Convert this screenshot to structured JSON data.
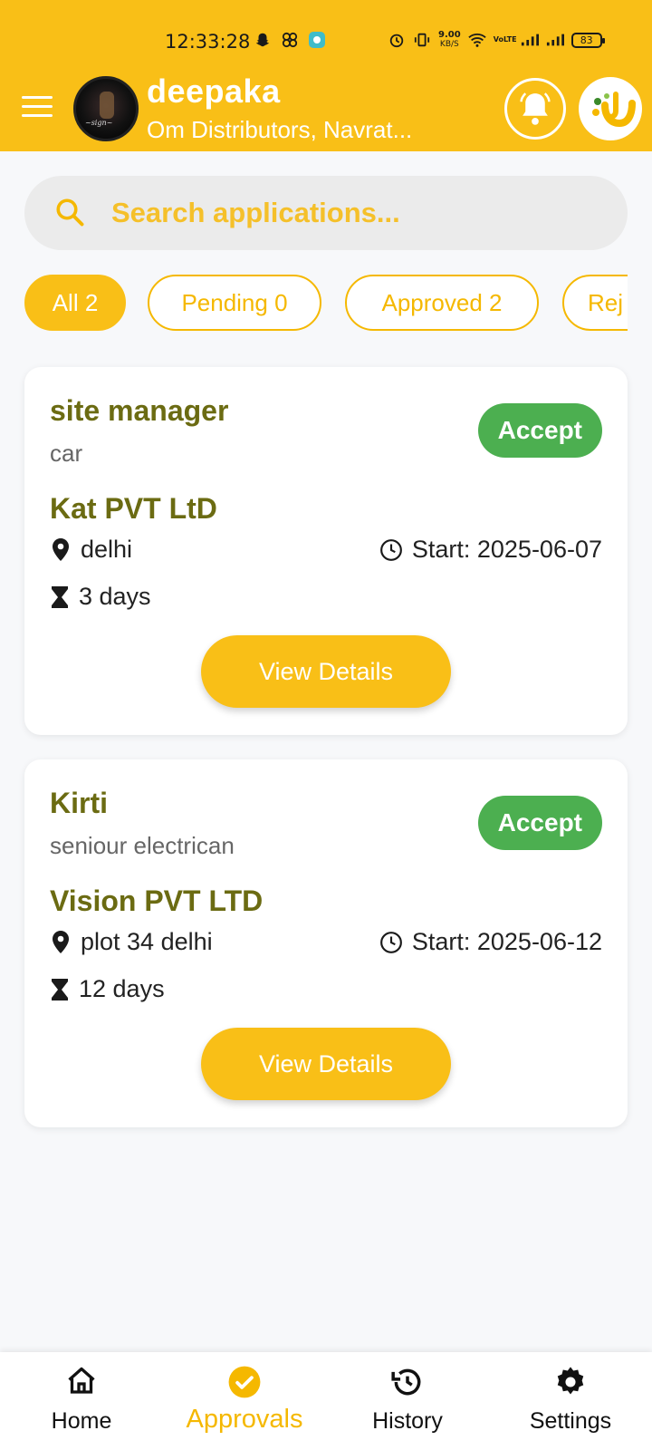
{
  "status_bar": {
    "time": "12:33:28",
    "net_speed_value": "9.00",
    "net_speed_unit": "KB/S",
    "volte": "VoLTE",
    "battery": "83"
  },
  "header": {
    "user_name": "deepaka",
    "org_name": "Om Distributors, Navrat...",
    "brand_color": "#f9bf17"
  },
  "search": {
    "placeholder": "Search applications..."
  },
  "filters": [
    {
      "label": "All 2",
      "active": true
    },
    {
      "label": "Pending 0",
      "active": false
    },
    {
      "label": "Approved 2",
      "active": false
    },
    {
      "label": "Rej",
      "active": false
    }
  ],
  "applications": [
    {
      "title": "site manager",
      "subtitle": "car",
      "company": "Kat PVT LtD",
      "status": "Accept",
      "location": "delhi",
      "start": "Start: 2025-06-07",
      "duration": "3 days",
      "button": "View Details"
    },
    {
      "title": "Kirti",
      "subtitle": "seniour electrican",
      "company": "Vision PVT LTD",
      "status": "Accept",
      "location": "plot 34 delhi",
      "start": "Start: 2025-06-12",
      "duration": "12 days",
      "button": "View Details"
    }
  ],
  "bottom_nav": [
    {
      "label": "Home",
      "icon": "home-icon",
      "active": false
    },
    {
      "label": "Approvals",
      "icon": "check-circle-icon",
      "active": true
    },
    {
      "label": "History",
      "icon": "history-icon",
      "active": false
    },
    {
      "label": "Settings",
      "icon": "gear-icon",
      "active": false
    }
  ],
  "colors": {
    "accent": "#f9bf17",
    "accept_badge": "#4caf50",
    "title_text": "#6b6b12"
  }
}
